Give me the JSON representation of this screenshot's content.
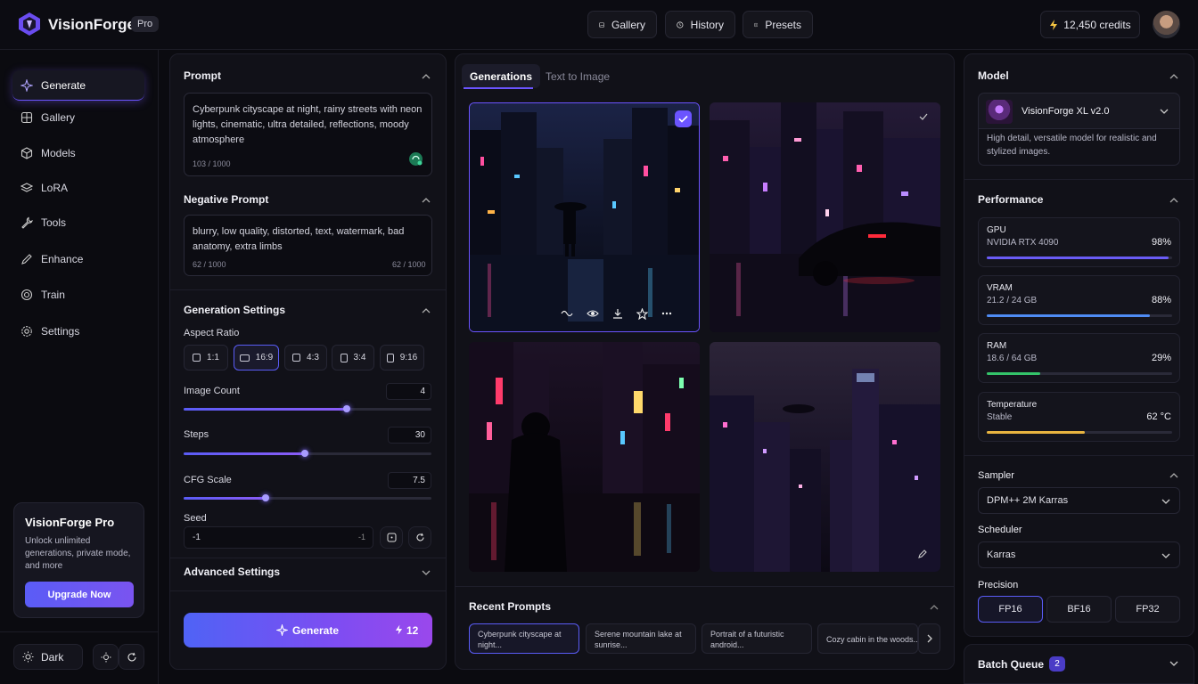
{
  "app": {
    "name": "VisionForge",
    "badge": "Pro"
  },
  "topnav": [
    {
      "label": "Gallery",
      "icon": "image-icon"
    },
    {
      "label": "History",
      "icon": "clock-icon"
    },
    {
      "label": "Presets",
      "icon": "preset-icon"
    }
  ],
  "credits": "12,450 credits",
  "sidebar": {
    "items": [
      {
        "label": "Generate",
        "active": true
      },
      {
        "label": "Gallery"
      },
      {
        "label": "Models"
      },
      {
        "label": "LoRA"
      },
      {
        "label": "Tools"
      },
      {
        "label": "Enhance"
      },
      {
        "label": "Train"
      },
      {
        "label": "Settings"
      }
    ],
    "promo": {
      "title": "VisionForge Pro",
      "text": "Unlock unlimited generations, private mode, and more",
      "button": "Upgrade Now"
    },
    "theme_label": "Dark"
  },
  "prompt": {
    "title": "Prompt",
    "text": "Cyberpunk cityscape at night, rainy streets with neon lights, cinematic, ultra detailed, reflections, moody atmosphere",
    "count": "103 / 1000"
  },
  "negative": {
    "title": "Negative Prompt",
    "text": "blurry, low quality, distorted, text, watermark, bad anatomy, extra limbs",
    "count": "62 / 1000",
    "count2": "62 / 1000"
  },
  "gen_settings": {
    "title": "Generation Settings",
    "aspect_label": "Aspect Ratio",
    "ratios": [
      "1:1",
      "16:9",
      "4:3",
      "3:4",
      "9:16"
    ],
    "selected_ratio": "16:9",
    "image_count": {
      "label": "Image Count",
      "value": "4",
      "fraction": 0.66
    },
    "steps": {
      "label": "Steps",
      "value": "30",
      "fraction": 0.49
    },
    "cfg": {
      "label": "CFG Scale",
      "value": "7.5",
      "fraction": 0.33
    },
    "seed": {
      "label": "Seed",
      "value": "-1",
      "suffix": "-1"
    },
    "advanced": "Advanced Settings"
  },
  "generate_button": {
    "label": "Generate",
    "cost": "12"
  },
  "tabs": [
    "Generations",
    "Text to Image"
  ],
  "recent": {
    "title": "Recent Prompts",
    "items": [
      "Cyberpunk cityscape at night...",
      "Serene mountain lake at sunrise...",
      "Portrait of a futuristic android...",
      "Cozy cabin in the woods..."
    ]
  },
  "model": {
    "title": "Model",
    "name": "VisionForge XL v2.0",
    "desc": "High detail, versatile model for realistic and stylized images."
  },
  "performance": {
    "title": "Performance",
    "items": [
      {
        "name": "GPU",
        "sub": "NVIDIA RTX 4090",
        "value": "98%",
        "fraction": 0.98,
        "color": "#6a5cf6"
      },
      {
        "name": "VRAM",
        "sub": "21.2 / 24 GB",
        "value": "88%",
        "fraction": 0.88,
        "color": "#4f8cf5"
      },
      {
        "name": "RAM",
        "sub": "18.6 / 64 GB",
        "value": "29%",
        "fraction": 0.29,
        "color": "#34c46a"
      },
      {
        "name": "Temperature",
        "sub": "Stable",
        "value": "62 °C",
        "fraction": 0.53,
        "color": "#e8b440"
      }
    ]
  },
  "sampler": {
    "title": "Sampler",
    "value": "DPM++ 2M Karras"
  },
  "scheduler": {
    "title": "Scheduler",
    "value": "Karras"
  },
  "precision": {
    "title": "Precision",
    "options": [
      "FP16",
      "BF16",
      "FP32"
    ],
    "selected": "FP16"
  },
  "batch": {
    "title": "Batch Queue",
    "count": "2"
  }
}
